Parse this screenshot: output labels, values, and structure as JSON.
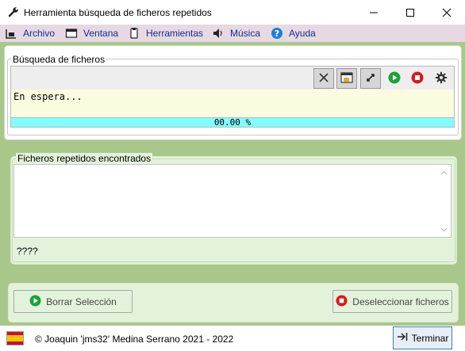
{
  "window": {
    "title": "Herramienta búsqueda de ficheros repetidos",
    "controls": [
      "minimize-icon",
      "maximize-icon",
      "close-icon"
    ]
  },
  "menu": {
    "items": [
      {
        "label": "Archivo",
        "icon": "file-icon"
      },
      {
        "label": "Ventana",
        "icon": "window-icon"
      },
      {
        "label": "Herramientas",
        "icon": "tools-icon"
      },
      {
        "label": "Música",
        "icon": "speaker-icon"
      },
      {
        "label": "Ayuda",
        "icon": "help-icon"
      }
    ]
  },
  "search": {
    "group_title": "Búsqueda de ficheros",
    "status_text": "En espera...",
    "progress_text": "00.00 %",
    "progress_value": 0,
    "toolbar_icons": [
      "clear-icon",
      "folder-window-icon",
      "expand-icon",
      "play-icon",
      "stop-icon",
      "settings-icon"
    ]
  },
  "results": {
    "group_title": "Ficheros repetidos encontrados",
    "summary": "????"
  },
  "actions": {
    "delete_selection": "Borrar Selección",
    "deselect_files": "Deseleccionar ficheros"
  },
  "footer": {
    "copyright": "© Joaquin 'jms32' Medina Serrano 2021 - 2022",
    "exit_label": "Terminar",
    "flag_icon": "spain-flag-icon"
  },
  "colors": {
    "background": "#a9c78b",
    "menubar": "#e6d9e4",
    "menu_text": "#1a2a8c",
    "status_background": "#fbfbe0",
    "progress_fill": "#7fffff",
    "play_green": "#1aa33a",
    "stop_red": "#d81b1b"
  }
}
